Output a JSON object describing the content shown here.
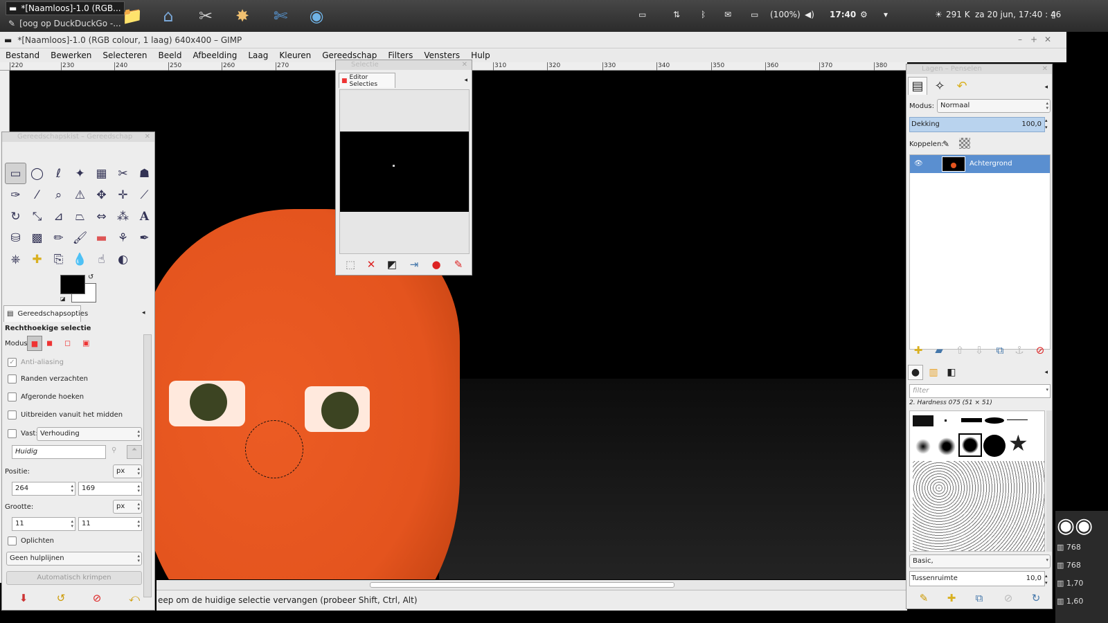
{
  "taskbar": {
    "tasks": [
      {
        "label": "*[Naamloos]-1.0 (RGB..."
      },
      {
        "label": "[oog op DuckDuckGo -..."
      }
    ],
    "launchers": [
      "folder-icon",
      "home-icon",
      "tools-icon",
      "firework-icon",
      "scissors-icon",
      "globe-icon"
    ],
    "battery": "(100%)",
    "time": "17:40",
    "net_speed": "291 K",
    "datetime": "za 20 jun, 17:40 : 46"
  },
  "window": {
    "title": "*[Naamloos]-1.0 (RGB colour, 1 laag) 640x400 – GIMP",
    "controls": {
      "minimize": "–",
      "maximize": "+",
      "close": "✕"
    }
  },
  "menu": [
    "Bestand",
    "Bewerken",
    "Selecteren",
    "Beeld",
    "Afbeelding",
    "Laag",
    "Kleuren",
    "Gereedschap",
    "Filters",
    "Vensters",
    "Hulp"
  ],
  "ruler": [
    "220",
    "230",
    "240",
    "250",
    "260",
    "270",
    "310",
    "320",
    "330",
    "340",
    "350",
    "360",
    "370",
    "380"
  ],
  "toolbox": {
    "title": "Gereedschapskist – Gereedschap",
    "tab_label": "Gereedschapsopties",
    "tool_name": "Rechthoekige selectie",
    "mode_label": "Modus:",
    "options": {
      "antialias": "Anti-aliasing",
      "feather": "Randen verzachten",
      "rounded": "Afgeronde hoeken",
      "expand_center": "Uitbreiden vanuit het midden",
      "fixed": "Vast:",
      "fixed_value": "Verhouding",
      "current": "Huidig",
      "position_label": "Positie:",
      "position_unit": "px",
      "pos_x": "264",
      "pos_y": "169",
      "size_label": "Grootte:",
      "size_unit": "px",
      "size_w": "11",
      "size_h": "11",
      "highlight": "Oplichten",
      "guides": "Geen hulplijnen",
      "autoshrink": "Automatisch krimpen"
    }
  },
  "selection_editor": {
    "title": "Selectie",
    "tab_label": "Editor Selecties"
  },
  "layers": {
    "title": "Lagen – Penselen",
    "mode_label": "Modus:",
    "mode_value": "Normaal",
    "opacity_label": "Dekking",
    "opacity_value": "100,0",
    "link_label": "Koppelen:",
    "layer_name": "Achtergrond",
    "brush_filter_placeholder": "filter",
    "brush_name": "2. Hardness 075 (51 × 51)",
    "brush_preset": "Basic,",
    "spacing_label": "Tussenruimte",
    "spacing_value": "10,0"
  },
  "statusbar": {
    "text": "eep om de huidige selectie vervangen (probeer Shift, Ctrl, Alt)"
  },
  "right_strip": [
    "768",
    "768",
    "1,70",
    "1,60"
  ],
  "colors": {
    "accent": "#5a8fd0",
    "face": "#e4541e",
    "canvas_bg": "#000000"
  }
}
